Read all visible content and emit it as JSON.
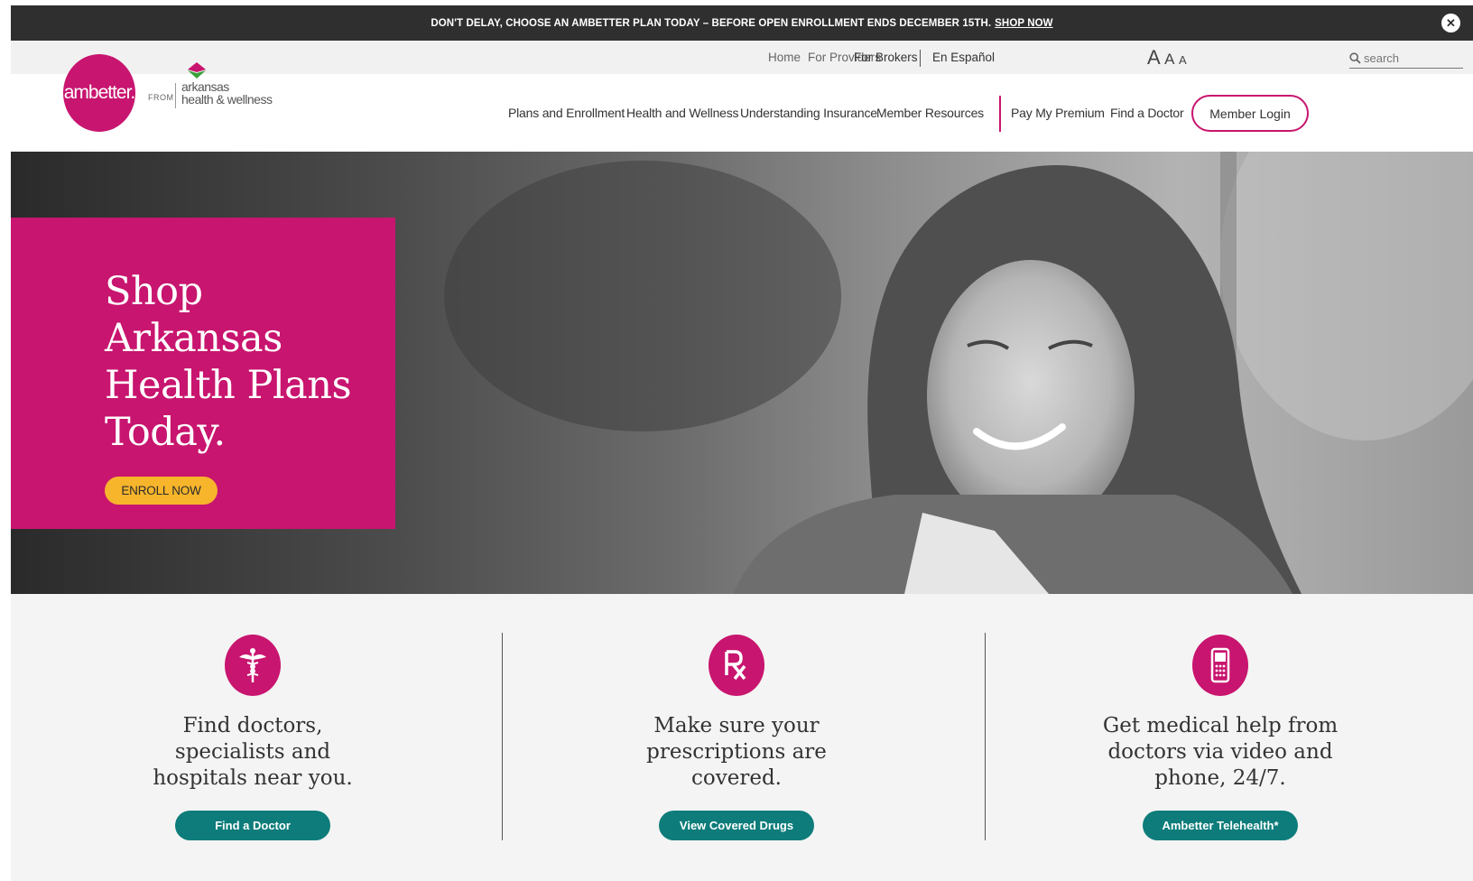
{
  "banner": {
    "message": "DON'T DELAY, CHOOSE AN AMBETTER PLAN TODAY –  BEFORE OPEN ENROLLMENT ENDS DECEMBER 15TH.",
    "link": "SHOP NOW",
    "close_icon": "close-icon"
  },
  "utility": {
    "links": [
      "Home",
      "For Providers",
      "For Brokers",
      "En Español"
    ],
    "text_size": [
      "A",
      "A",
      "A"
    ],
    "search_placeholder": "search"
  },
  "logo": {
    "brand": "ambetter.",
    "from": "FROM",
    "partner_line1": "arkansas",
    "partner_line2": "health & wellness"
  },
  "nav": {
    "items": [
      "Plans and Enrollment",
      "Health and Wellness",
      "Understanding Insurance",
      "Member Resources"
    ],
    "secondary": [
      "Pay My Premium",
      "Find a Doctor"
    ],
    "login": "Member Login"
  },
  "hero": {
    "title": "Shop Arkansas Health Plans Today.",
    "cta": "ENROLL NOW"
  },
  "features": [
    {
      "icon": "caduceus-icon",
      "text": "Find doctors, specialists and hospitals near you.",
      "button": "Find a Doctor"
    },
    {
      "icon": "rx-icon",
      "text": "Make sure your prescriptions are covered.",
      "button": "View Covered Drugs"
    },
    {
      "icon": "phone-icon",
      "text": "Get medical help from doctors via video and phone, 24/7.",
      "button": "Ambetter Telehealth*"
    }
  ],
  "colors": {
    "brand_magenta": "#c8156f",
    "teal_button": "#0d7c7a",
    "cta_yellow": "#f7b52b",
    "banner_dark": "#2f2f2f"
  }
}
